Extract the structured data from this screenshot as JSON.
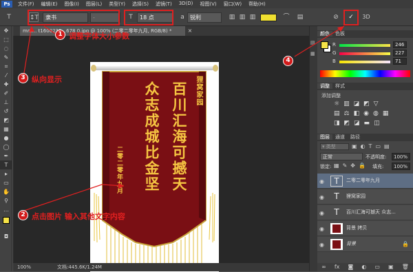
{
  "menu": {
    "logo": "Ps",
    "items": [
      "文件(F)",
      "编辑(E)",
      "图像(I)",
      "图层(L)",
      "类型(Y)",
      "选择(S)",
      "滤镜(T)",
      "3D(D)",
      "视图(V)",
      "窗口(W)",
      "帮助(H)"
    ]
  },
  "options": {
    "font_family": "隶书",
    "font_size": "18 点",
    "antialias": "锐利",
    "color_swatch": "#f0e030"
  },
  "document": {
    "tab_title": "mm... t1600230...678 0.jpg @ 100% (二零二零年九月, RGB/8) *",
    "zoom": "100%",
    "doc_info": "文档:445.6K/1.24M"
  },
  "banner": {
    "header": "狸窝家园",
    "col1": "百川汇海可撼天",
    "col2": "众志成城比金坚",
    "date": "二零二零年九月",
    "bg_color": "#7a0f14",
    "text_color": "#f5c542"
  },
  "color_panel": {
    "tab_active": "颜色",
    "tab_other": "色板",
    "r": "246",
    "g": "227",
    "b": "71"
  },
  "adjust_panel": {
    "tab_active": "调整",
    "tab_other": "样式",
    "title": "添加调整"
  },
  "layers_panel": {
    "tabs": [
      "图层",
      "通道",
      "路径"
    ],
    "blend_mode": "正常",
    "opacity_label": "不透明度:",
    "opacity": "100%",
    "lock_label": "锁定:",
    "fill_label": "填充:",
    "fill": "100%",
    "layers": [
      {
        "name": "二零二零年九月",
        "type": "text",
        "selected": true
      },
      {
        "name": "狸窝家园",
        "type": "text",
        "selected": false
      },
      {
        "name": "百川汇海可撼天 众志...",
        "type": "text",
        "selected": false
      },
      {
        "name": "背景 拷贝",
        "type": "image",
        "selected": false
      },
      {
        "name": "背景",
        "type": "image",
        "selected": false
      }
    ]
  },
  "callouts": {
    "c1": {
      "num": "1",
      "text": "调整字体大小参数"
    },
    "c2": {
      "num": "2",
      "text": "点击图片  输入其他文字内容"
    },
    "c3": {
      "num": "3",
      "text": "纵向显示"
    },
    "c4": {
      "num": "4"
    }
  }
}
